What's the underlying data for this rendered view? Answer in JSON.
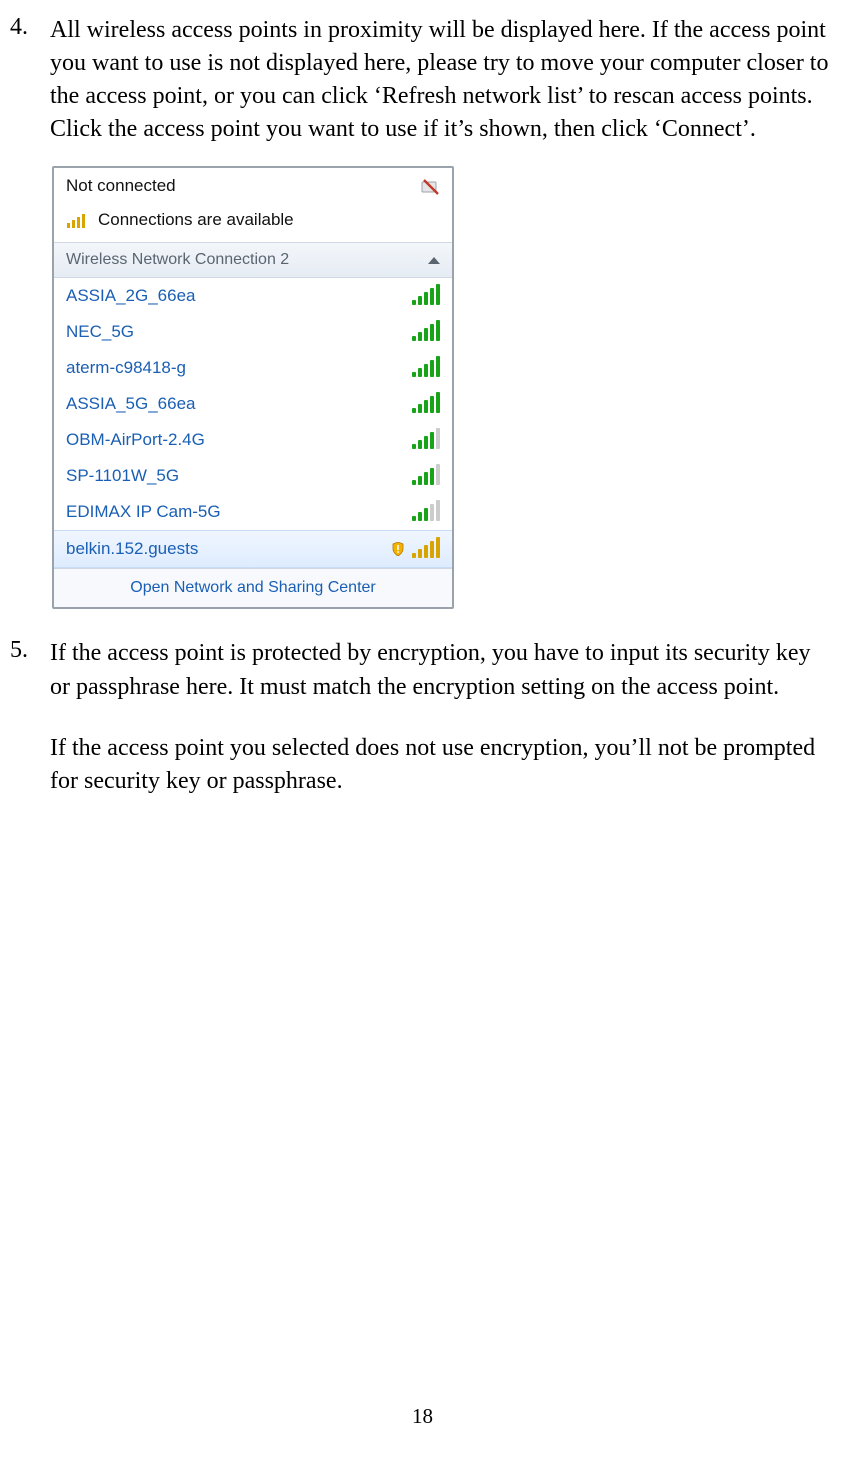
{
  "step4": {
    "number": "4.",
    "text": "All wireless access points in proximity will be displayed here. If the access point you want to use is not displayed here, please try to move your computer closer to the access point, or you can click ‘Refresh network list’ to rescan access points. Click the access point you want to use if it’s shown, then click ‘Connect’."
  },
  "popup": {
    "status": "Not connected",
    "available": "Connections are available",
    "section_title": "Wireless Network Connection 2",
    "networks": [
      {
        "name": "ASSIA_2G_66ea",
        "signal": 5,
        "secure": true,
        "open": false
      },
      {
        "name": "NEC_5G",
        "signal": 5,
        "secure": true,
        "open": false
      },
      {
        "name": "aterm-c98418-g",
        "signal": 5,
        "secure": true,
        "open": false
      },
      {
        "name": "ASSIA_5G_66ea",
        "signal": 5,
        "secure": true,
        "open": false
      },
      {
        "name": "OBM-AirPort-2.4G",
        "signal": 4,
        "secure": true,
        "open": false
      },
      {
        "name": "SP-1101W_5G",
        "signal": 4,
        "secure": true,
        "open": false
      },
      {
        "name": "EDIMAX IP Cam-5G",
        "signal": 3,
        "secure": true,
        "open": false
      },
      {
        "name": "belkin.152.guests",
        "signal": 5,
        "secure": false,
        "open": true,
        "selected": true
      }
    ],
    "footer_link": "Open Network and Sharing Center"
  },
  "step5": {
    "number": "5.",
    "text_a": "If the access point is protected by encryption, you have to input its security key or passphrase here. It must match the encryption setting on the access point.",
    "text_b": "If the access point you selected does not use encryption, you’ll not be prompted for security key or passphrase."
  },
  "page_number": "18"
}
